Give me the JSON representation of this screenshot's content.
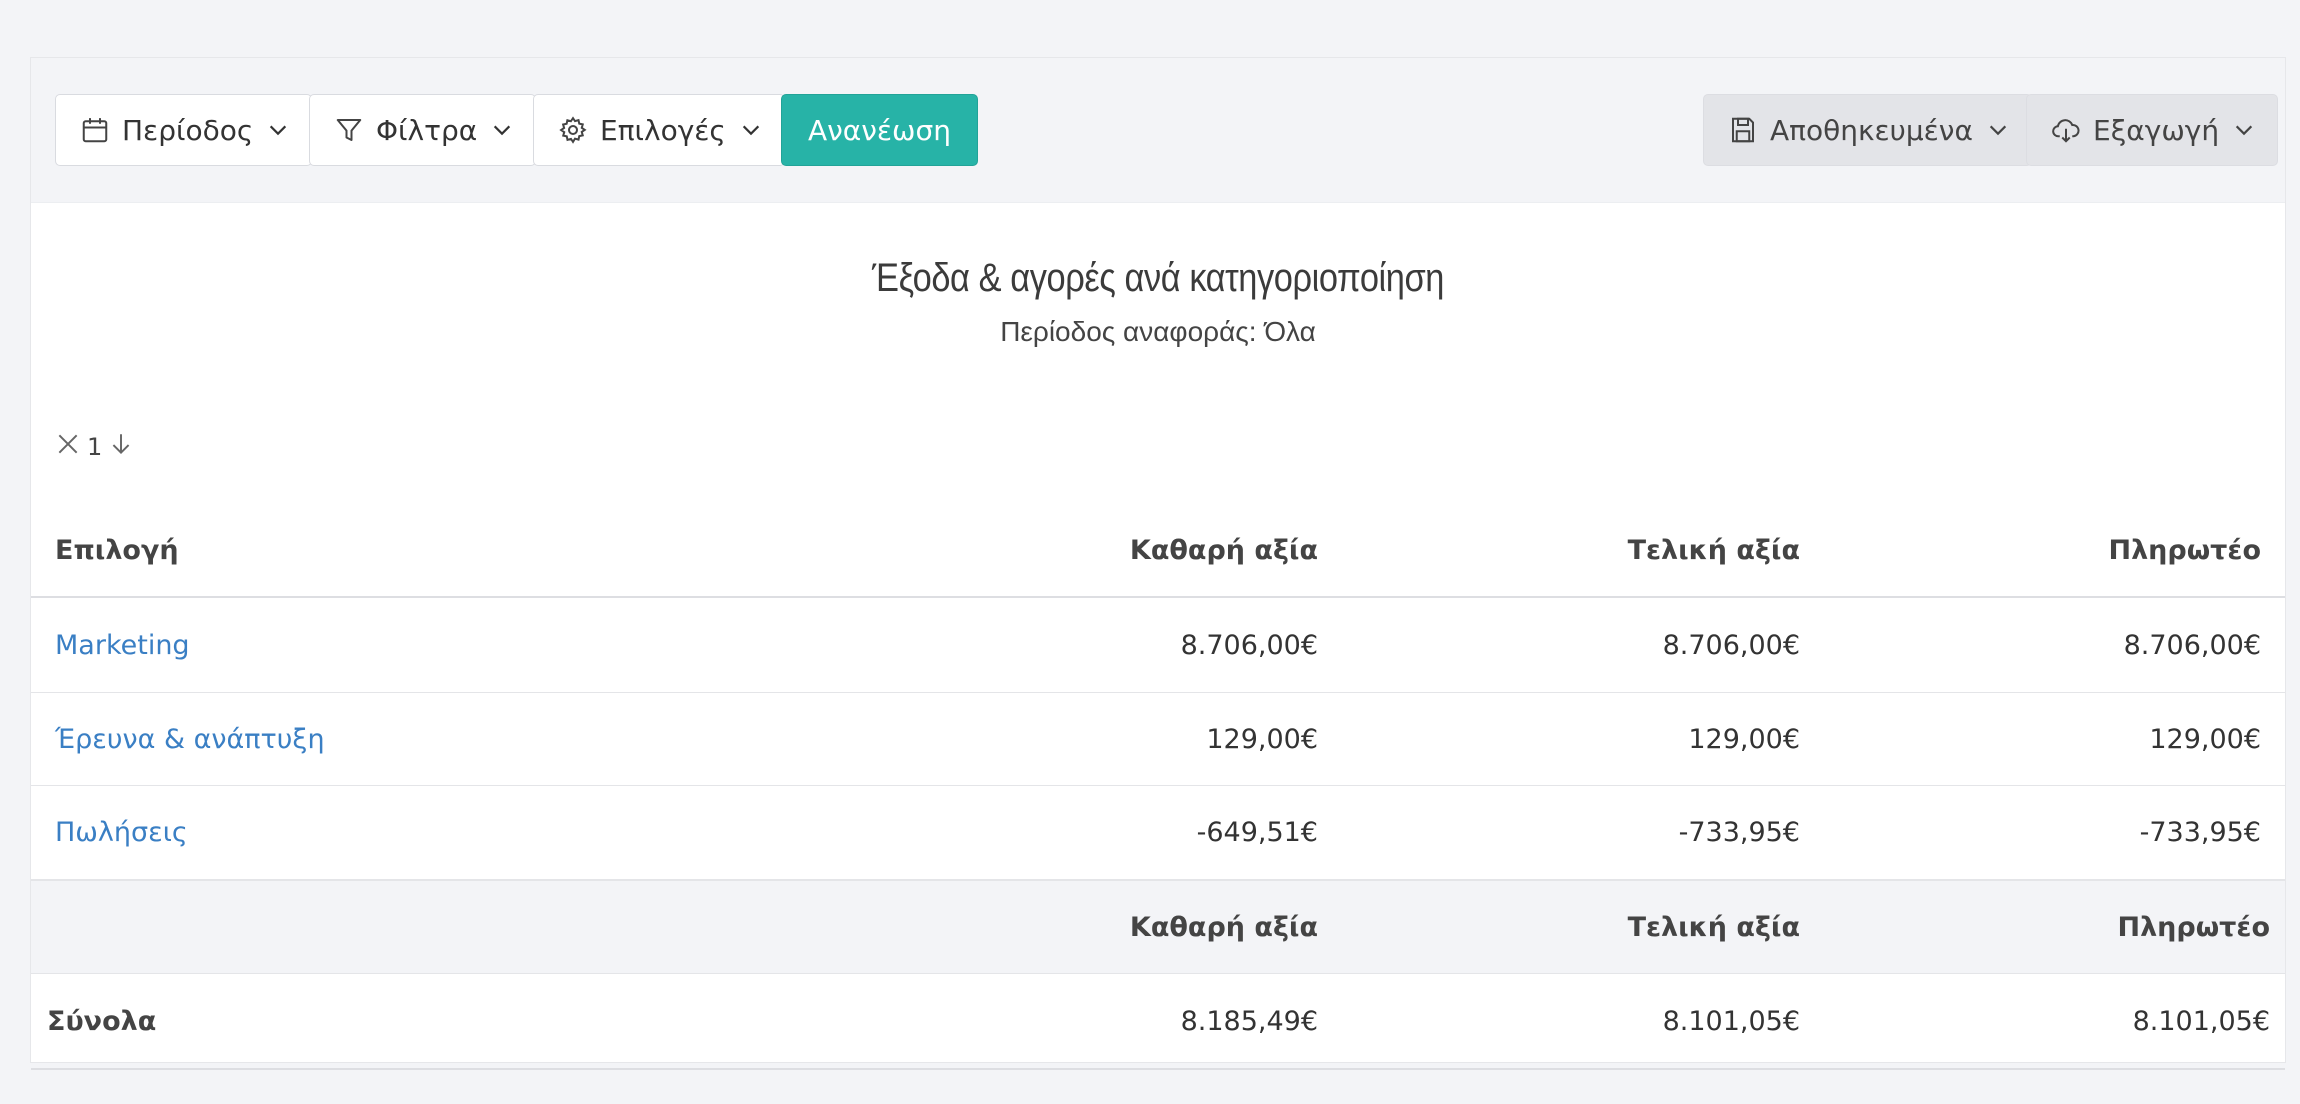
{
  "toolbar": {
    "period_label": "Περίοδος",
    "filters_label": "Φίλτρα",
    "options_label": "Επιλογές",
    "refresh_label": "Ανανέωση",
    "saved_label": "Αποθηκευμένα",
    "export_label": "Εξαγωγή"
  },
  "report": {
    "title": "Έξοδα & αγορές ανά κατηγοριοποίηση",
    "subtitle": "Περίοδος αναφοράς: Όλα"
  },
  "sort": {
    "level": "1"
  },
  "table": {
    "columns": [
      "Επιλογή",
      "Καθαρή αξία",
      "Τελική αξία",
      "Πληρωτέο"
    ],
    "rows": [
      {
        "label": "Marketing",
        "net": "8.706,00€",
        "final": "8.706,00€",
        "payable": "8.706,00€"
      },
      {
        "label": "Έρευνα & ανάπτυξη",
        "net": "129,00€",
        "final": "129,00€",
        "payable": "129,00€"
      },
      {
        "label": "Πωλήσεις",
        "net": "-649,51€",
        "final": "-733,95€",
        "payable": "-733,95€"
      }
    ],
    "totals_header": [
      "Καθαρή αξία",
      "Τελική αξία",
      "Πληρωτέο"
    ],
    "totals": {
      "label": "Σύνολα",
      "net": "8.185,49€",
      "final": "8.101,05€",
      "payable": "8.101,05€"
    }
  }
}
